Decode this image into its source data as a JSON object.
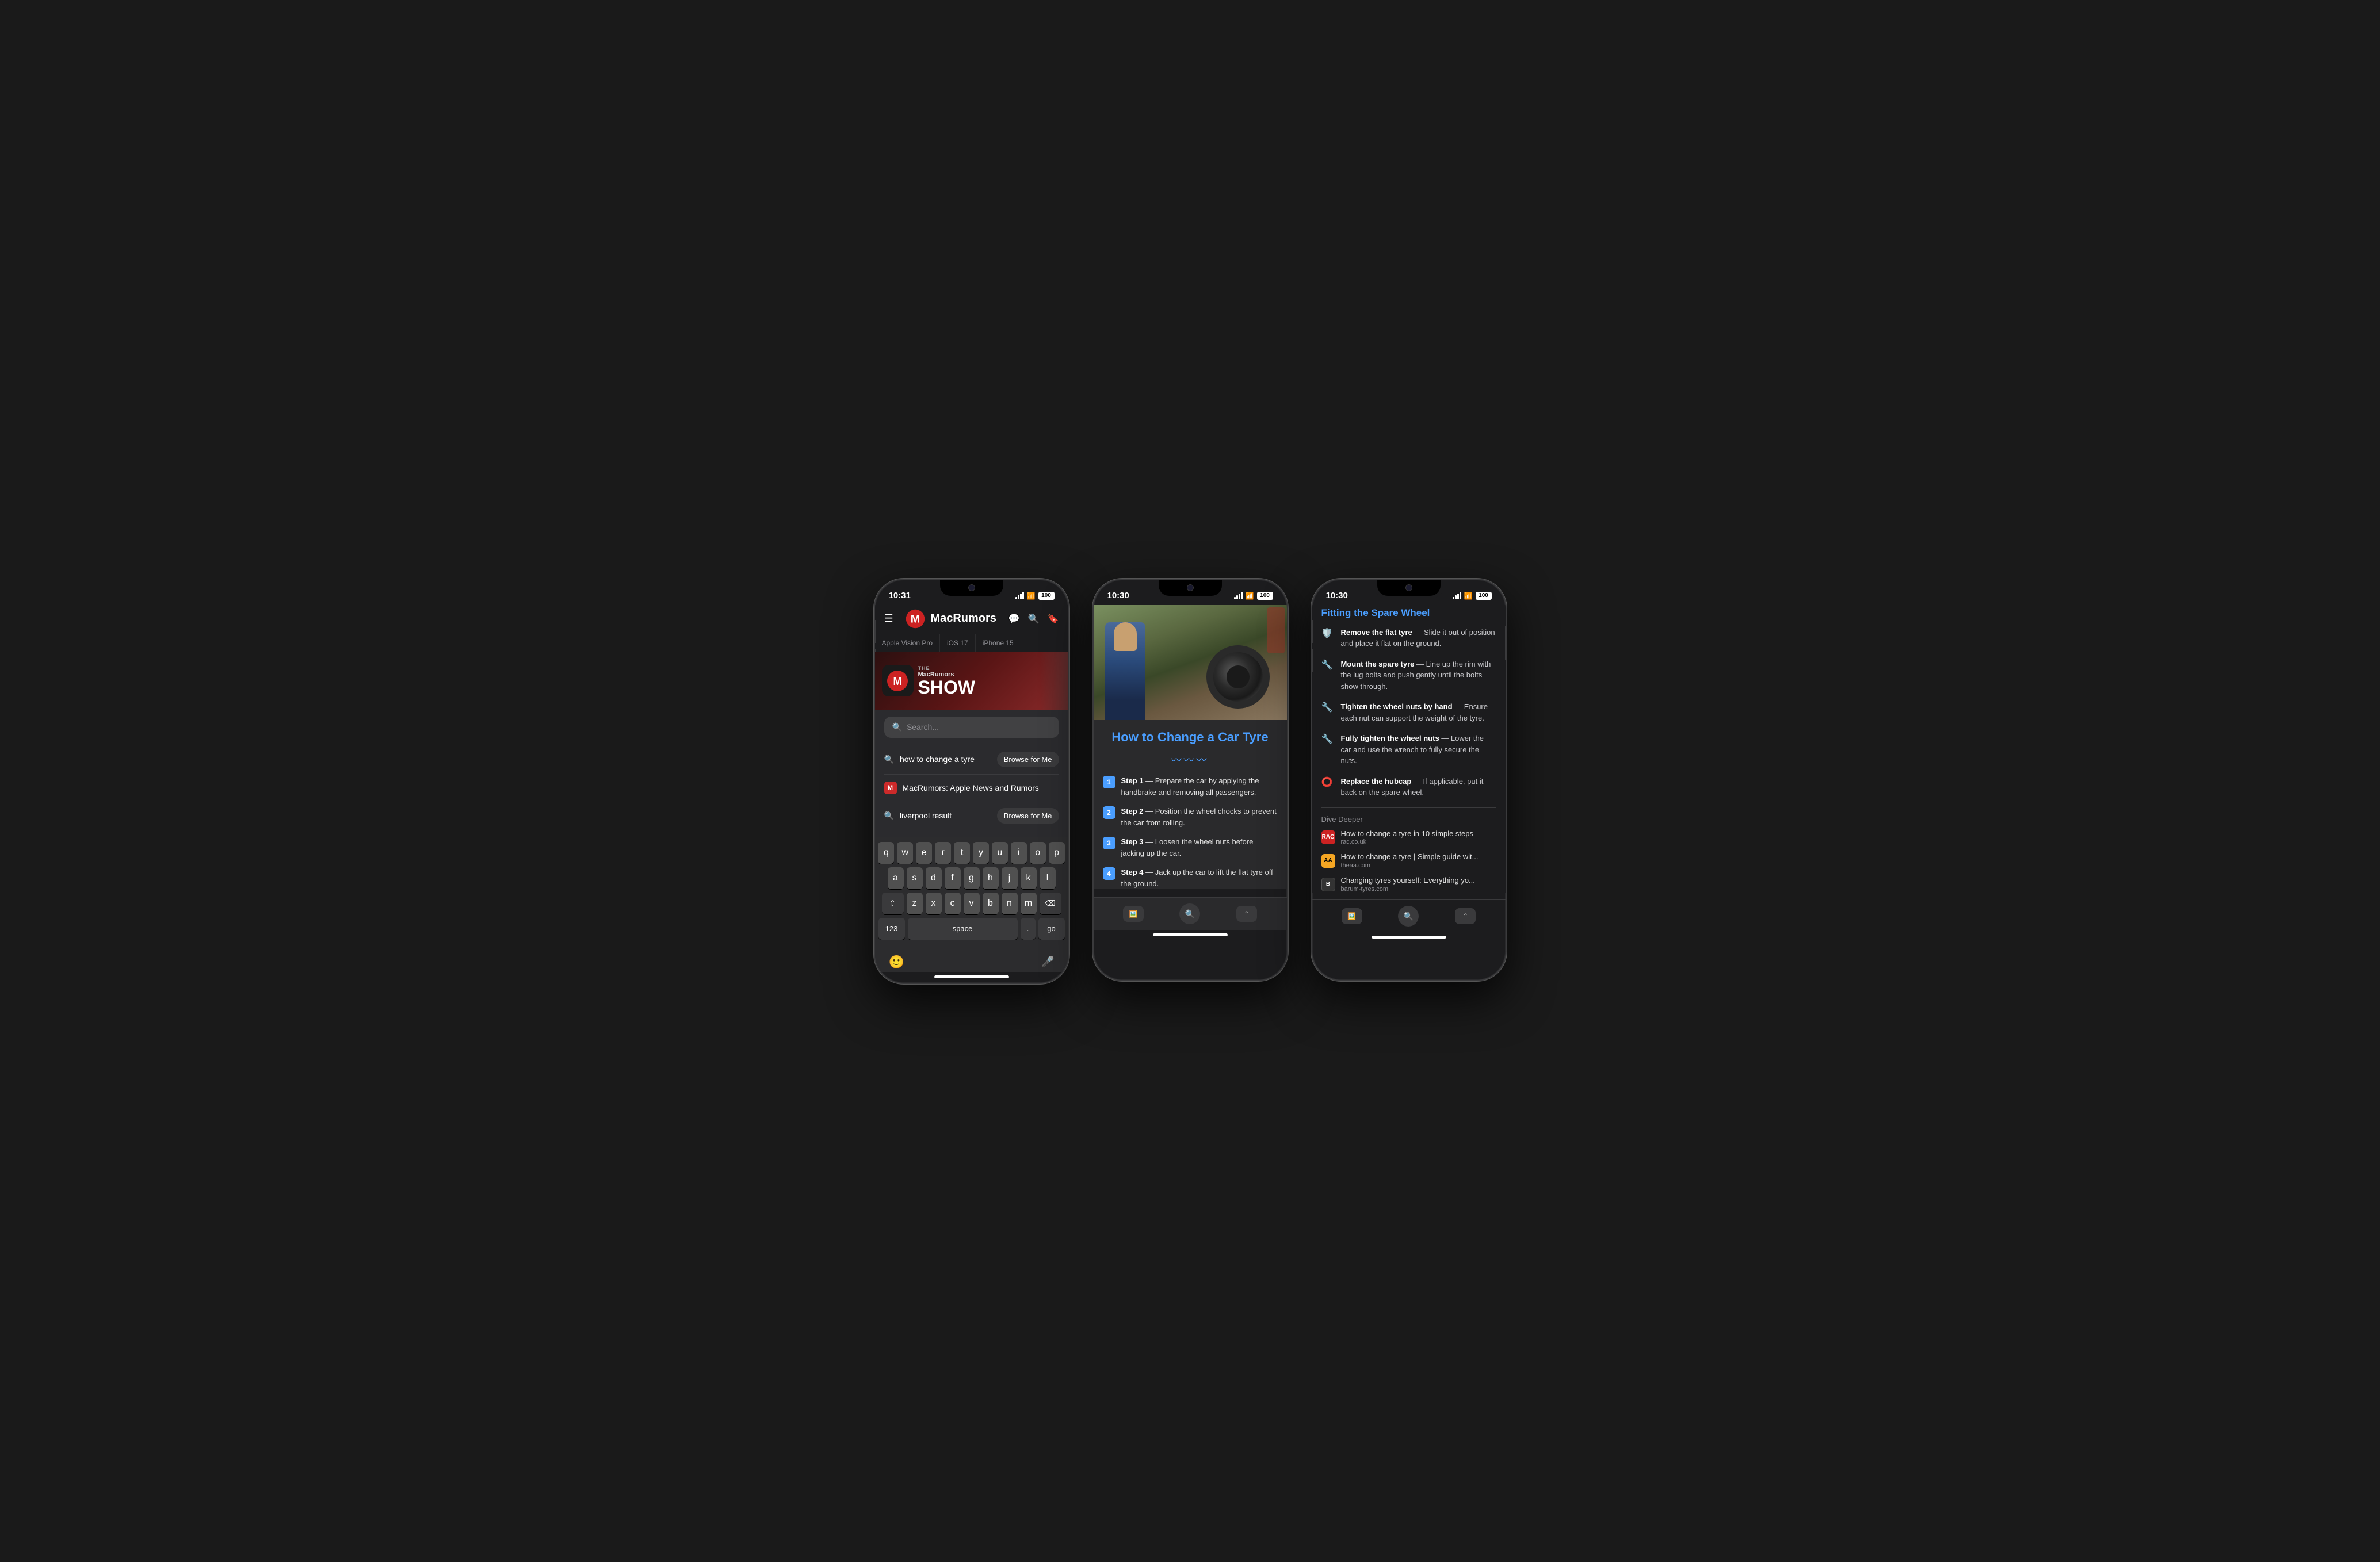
{
  "phone1": {
    "time": "10:31",
    "battery": "100",
    "nav": {
      "logo": "MacRumors",
      "icons": [
        "comment",
        "search",
        "bookmark"
      ]
    },
    "topics": [
      "Apple Vision Pro",
      "iOS 17",
      "iPhone 15"
    ],
    "banner": {
      "title": "MacRumors",
      "subtitle": "SHOW",
      "badge": "THE"
    },
    "search": {
      "placeholder": "Search...",
      "suggestions": [
        {
          "icon": "search",
          "text": "how to change a tyre",
          "browse_btn": "Browse for Me"
        },
        {
          "icon": "macrumors",
          "text": "MacRumors: Apple News and Rumors",
          "browse_btn": null
        },
        {
          "icon": "search",
          "text": "liverpool result",
          "browse_btn": "Browse for Me"
        }
      ]
    },
    "keyboard": {
      "rows": [
        [
          "q",
          "w",
          "e",
          "r",
          "t",
          "y",
          "u",
          "i",
          "o",
          "p"
        ],
        [
          "a",
          "s",
          "d",
          "f",
          "g",
          "h",
          "j",
          "k",
          "l"
        ],
        [
          "z",
          "x",
          "c",
          "v",
          "b",
          "n",
          "m"
        ],
        [
          "123",
          "space",
          ".",
          "go"
        ]
      ],
      "shift_key": "⇧",
      "backspace_key": "⌫",
      "space_label": "space"
    }
  },
  "phone2": {
    "time": "10:30",
    "battery": "100",
    "article": {
      "title": "How to Change a Car Tyre",
      "divider": "~~~",
      "steps": [
        {
          "num": "1",
          "text": "Step 1",
          "desc": "— Prepare the car by applying the handbrake and removing all passengers."
        },
        {
          "num": "2",
          "text": "Step 2",
          "desc": "— Position the wheel chocks to prevent the car from rolling."
        },
        {
          "num": "3",
          "text": "Step 3",
          "desc": "— Loosen the wheel nuts before jacking up the car."
        },
        {
          "num": "4",
          "text": "Step 4",
          "desc": "— Jack up the car to lift the flat tyre off the ground."
        }
      ]
    }
  },
  "phone3": {
    "time": "10:30",
    "battery": "100",
    "section_title": "Fitting the Spare Wheel",
    "instructions": [
      {
        "icon": "shield",
        "title": "Remove the flat tyre",
        "desc": "— Slide it out of position and place it flat on the ground."
      },
      {
        "icon": "wrench",
        "title": "Mount the spare tyre",
        "desc": "— Line up the rim with the lug bolts and push gently until the bolts show through."
      },
      {
        "icon": "wrench",
        "title": "Tighten the wheel nuts by hand",
        "desc": "— Ensure each nut can support the weight of the tyre."
      },
      {
        "icon": "wrench",
        "title": "Fully tighten the wheel nuts",
        "desc": "— Lower the car and use the wrench to fully secure the nuts."
      },
      {
        "icon": "circle",
        "title": "Replace the hubcap",
        "desc": "— If applicable, put it back on the spare wheel."
      }
    ],
    "dive_deeper": {
      "label": "Dive Deeper",
      "sources": [
        {
          "favicon_text": "RAC",
          "favicon_class": "rac",
          "title": "How to change a tyre in 10 simple steps",
          "url": "rac.co.uk"
        },
        {
          "favicon_text": "AA",
          "favicon_class": "aa",
          "title": "How to change a tyre | Simple guide wit...",
          "url": "theaa.com"
        },
        {
          "favicon_text": "B",
          "favicon_class": "barum",
          "title": "Changing tyres yourself: Everything yo...",
          "url": "barum-tyres.com"
        }
      ]
    }
  }
}
